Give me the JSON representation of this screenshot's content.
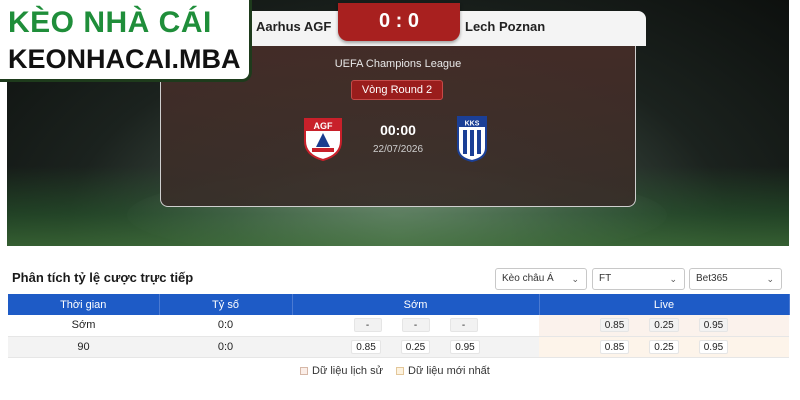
{
  "brand": {
    "line1": "KÈO NHÀ CÁI",
    "line2": "KEONHACAI.MBA"
  },
  "match": {
    "home_team": "Aarhus AGF",
    "away_team": "Lech Poznan",
    "score": "0 : 0",
    "league": "UEFA Champions League",
    "round": "Vòng Round 2",
    "kickoff": "00:00",
    "date": "22/07/2026",
    "home_logo_text": "AGF",
    "away_logo_text": "KKS"
  },
  "odds": {
    "title": "Phân tích tỷ lệ cược trực tiếp",
    "selects": {
      "type": "Kèo châu Á",
      "time": "FT",
      "bookmaker": "Bet365"
    },
    "headers": {
      "time": "Thời gian",
      "score": "Tỷ số",
      "early": "Sớm",
      "live": "Live"
    },
    "rows": [
      {
        "time": "Sớm",
        "score": "0:0",
        "early": [
          "-",
          "-",
          "-"
        ],
        "live": [
          "0.85",
          "0.25",
          "0.95"
        ]
      },
      {
        "time": "90",
        "score": "0:0",
        "early": [
          "0.85",
          "0.25",
          "0.95"
        ],
        "live": [
          "0.85",
          "0.25",
          "0.95"
        ]
      }
    ],
    "legend": {
      "history": "Dữ liệu lịch sử",
      "latest": "Dữ liệu mới nhất"
    }
  },
  "colors": {
    "header_blue": "#1e5bc6",
    "score_red": "#a8201f",
    "brand_green": "#1f8e3a"
  }
}
